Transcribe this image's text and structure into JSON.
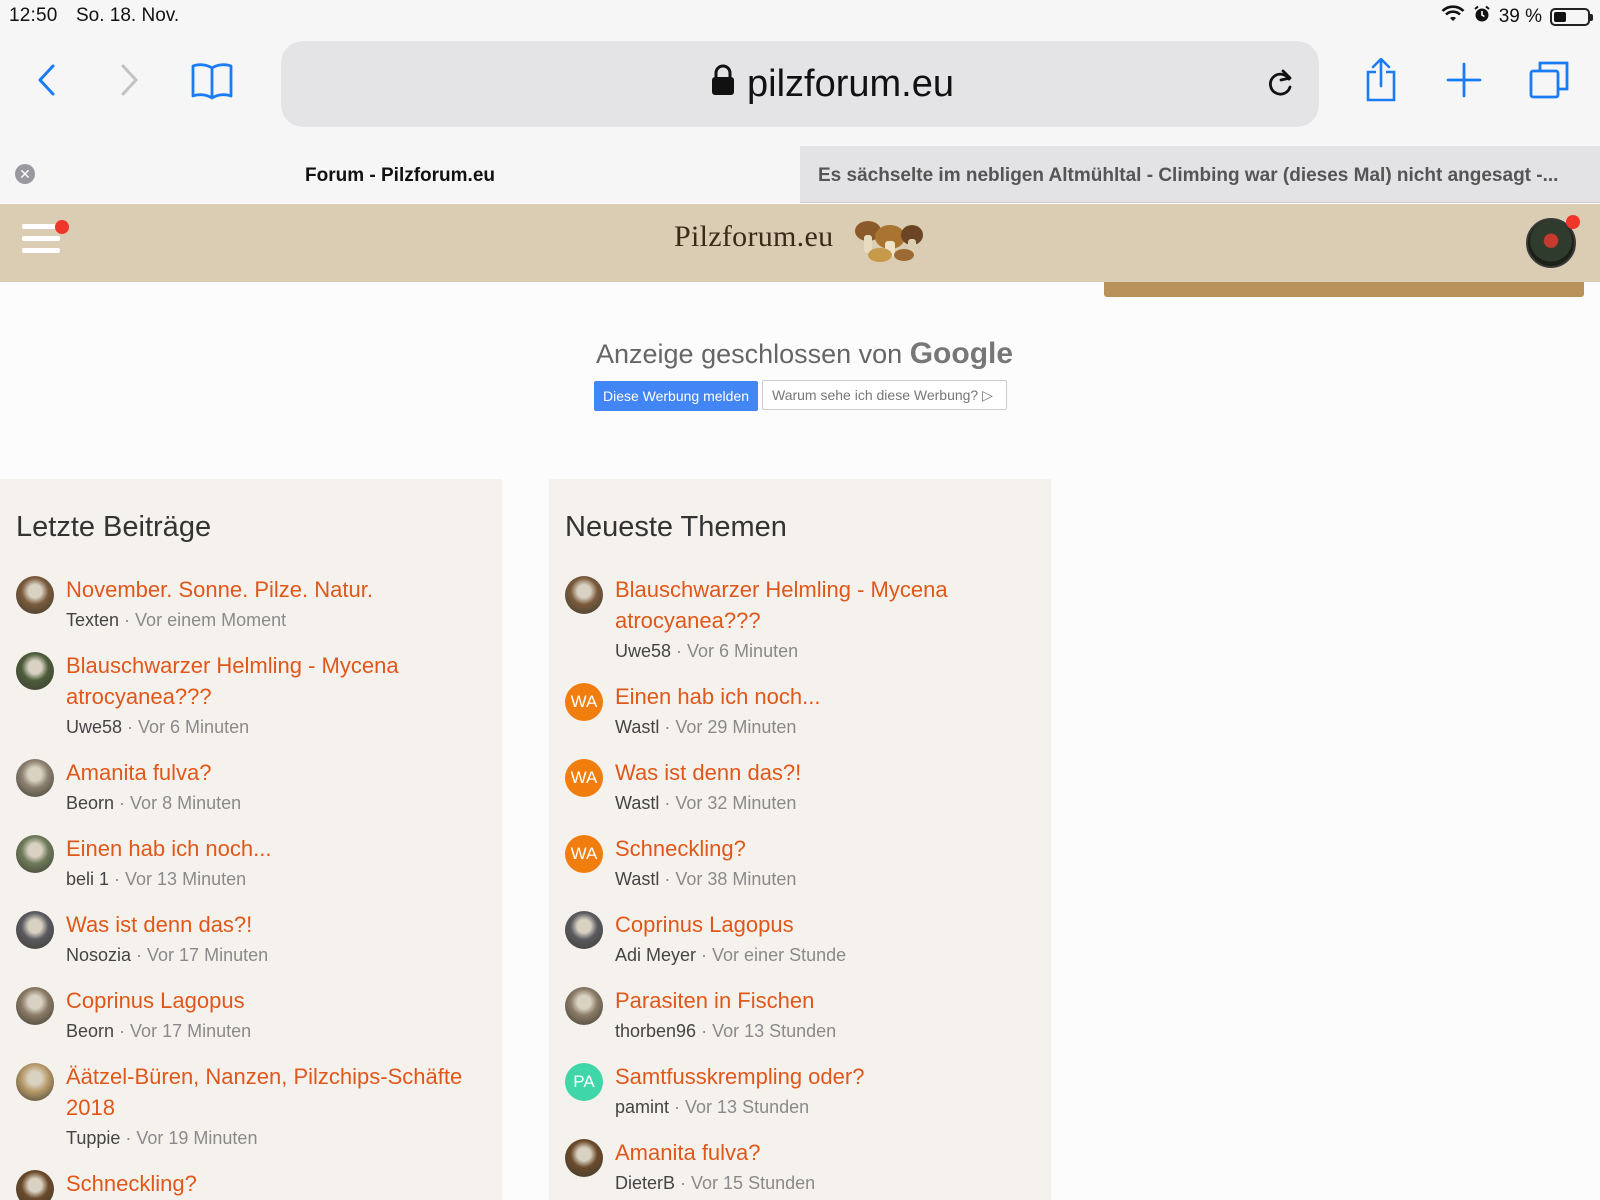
{
  "status_bar": {
    "time": "12:50",
    "date": "So. 18. Nov.",
    "battery_percent": "39 %",
    "battery_level": 0.39
  },
  "browser": {
    "url": "pilzforum.eu",
    "icons": [
      "back-icon",
      "forward-icon",
      "bookmarks-icon",
      "lock-icon",
      "reload-icon",
      "share-icon",
      "new-tab-icon",
      "tabs-icon"
    ],
    "tabs": [
      {
        "title": "Forum - Pilzforum.eu",
        "active": true
      },
      {
        "title": "Es sächselte im nebligen Altmühltal - Climbing war (dieses Mal) nicht angesagt -...",
        "active": false
      }
    ]
  },
  "site": {
    "logo_text": "Pilzforum.eu"
  },
  "ad": {
    "closed_text": "Anzeige geschlossen von",
    "brand": "Google",
    "report_button": "Diese Werbung melden",
    "why_button": "Warum sehe ich diese Werbung? ▷"
  },
  "colors": {
    "accent": "#e0571a",
    "header_bg": "#dbcdb4",
    "panel_bg": "#f5f2ee",
    "notification": "#f0362b"
  },
  "recent_posts": {
    "heading": "Letzte Beiträge",
    "items": [
      {
        "title": "November. Sonne. Pilze. Natur.",
        "author": "Texten",
        "time": "Vor einem Moment"
      },
      {
        "title": "Blauschwarzer Helmling - Mycena atrocyanea???",
        "author": "Uwe58",
        "time": "Vor 6 Minuten"
      },
      {
        "title": "Amanita fulva?",
        "author": "Beorn",
        "time": "Vor 8 Minuten"
      },
      {
        "title": "Einen hab ich noch...",
        "author": "beli 1",
        "time": "Vor 13 Minuten"
      },
      {
        "title": "Was ist denn das?!",
        "author": "Nosozia",
        "time": "Vor 17 Minuten"
      },
      {
        "title": "Coprinus Lagopus",
        "author": "Beorn",
        "time": "Vor 17 Minuten"
      },
      {
        "title": "Äätzel-Büren, Nanzen, Pilzchips-Schäfte 2018",
        "author": "Tuppie",
        "time": "Vor 19 Minuten"
      },
      {
        "title": "Schneckling?",
        "author": "",
        "time": ""
      }
    ]
  },
  "newest_topics": {
    "heading": "Neueste Themen",
    "items": [
      {
        "title": "Blauschwarzer Helmling - Mycena atrocyanea???",
        "author": "Uwe58",
        "time": "Vor 6 Minuten",
        "initials": ""
      },
      {
        "title": "Einen hab ich noch...",
        "author": "Wastl",
        "time": "Vor 29 Minuten",
        "initials": "WA"
      },
      {
        "title": "Was ist denn das?!",
        "author": "Wastl",
        "time": "Vor 32 Minuten",
        "initials": "WA"
      },
      {
        "title": "Schneckling?",
        "author": "Wastl",
        "time": "Vor 38 Minuten",
        "initials": "WA"
      },
      {
        "title": "Coprinus Lagopus",
        "author": "Adi Meyer",
        "time": "Vor einer Stunde",
        "initials": ""
      },
      {
        "title": "Parasiten in Fischen",
        "author": "thorben96",
        "time": "Vor 13 Stunden",
        "initials": ""
      },
      {
        "title": "Samtfusskrempling oder?",
        "author": "pamint",
        "time": "Vor 13 Stunden",
        "initials": "PA"
      },
      {
        "title": "Amanita fulva?",
        "author": "DieterB",
        "time": "Vor 15 Stunden",
        "initials": ""
      }
    ]
  }
}
